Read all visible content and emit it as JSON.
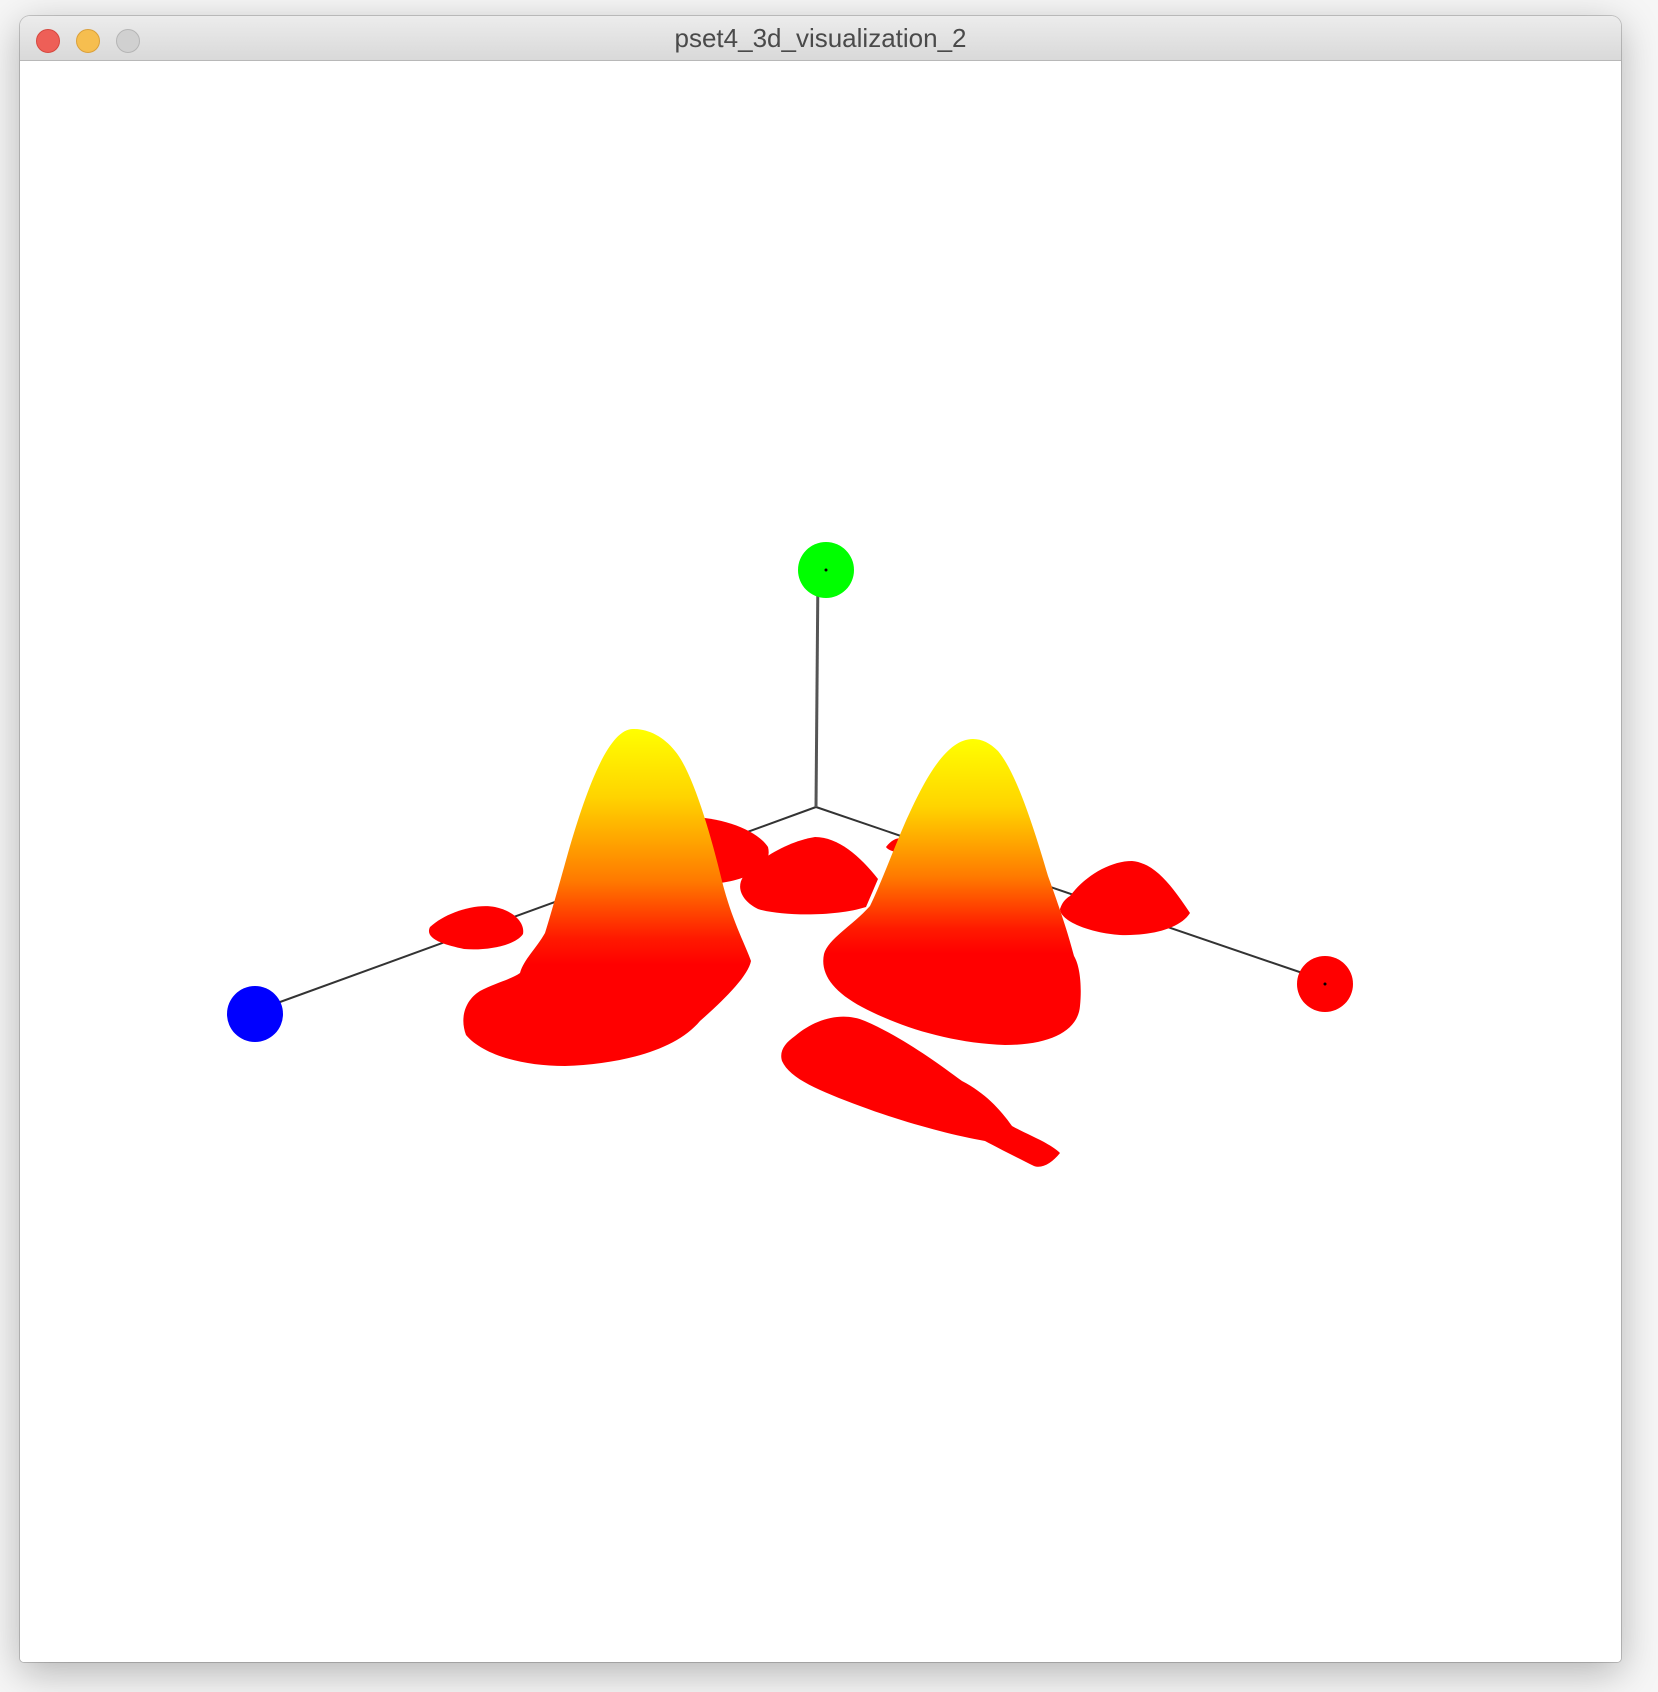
{
  "window": {
    "title": "pset4_3d_visualization_2",
    "controls": {
      "close_icon": "close-icon",
      "minimize_icon": "minimize-icon",
      "zoom_icon": "zoom-icon"
    }
  },
  "scene": {
    "background": "#ffffff",
    "axis_line_color": "#000000",
    "axis_markers": [
      {
        "axis": "x",
        "color": "#ff0000"
      },
      {
        "axis": "y",
        "color": "#00ff00"
      },
      {
        "axis": "z",
        "color": "#0000ff"
      }
    ],
    "surface_gradient": {
      "low": "#ff0000",
      "mid": "#ff8000",
      "high": "#ffff00"
    }
  }
}
